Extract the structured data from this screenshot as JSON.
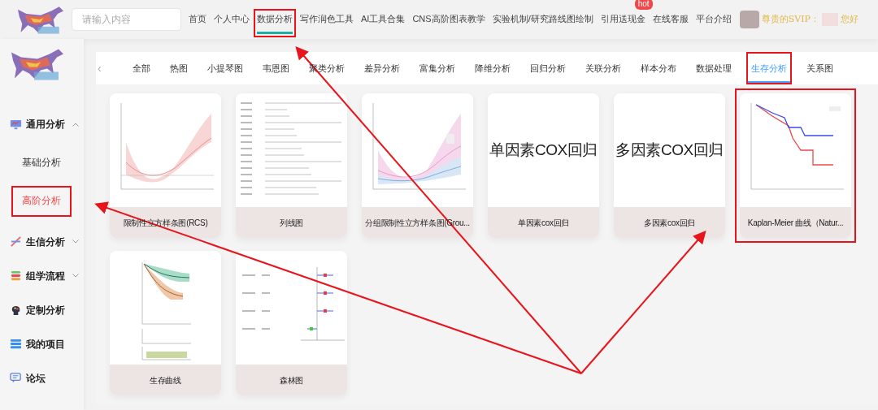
{
  "header": {
    "search": {
      "placeholder": "请输入内容"
    },
    "nav": [
      {
        "label": "首页",
        "selected": false,
        "highlighted": false
      },
      {
        "label": "个人中心",
        "selected": false,
        "highlighted": false
      },
      {
        "label": "数据分析",
        "selected": true,
        "highlighted": true
      },
      {
        "label": "写作润色工具",
        "selected": false,
        "highlighted": false
      },
      {
        "label": "AI工具合集",
        "selected": false,
        "highlighted": false
      },
      {
        "label": "CNS高阶图表教学",
        "selected": false,
        "highlighted": false
      },
      {
        "label": "实验机制/研究路线图绘制",
        "selected": false,
        "highlighted": false
      },
      {
        "label": "引用送现金",
        "selected": false,
        "highlighted": false,
        "badge": "hot"
      },
      {
        "label": "在线客服",
        "selected": false,
        "highlighted": false
      },
      {
        "label": "平台介绍",
        "selected": false,
        "highlighted": false
      }
    ],
    "greeting": {
      "prefix": "尊贵的SVIP：",
      "suffix": "您好"
    }
  },
  "sidebar": {
    "items": [
      {
        "label": "通用分析",
        "kind": "group",
        "expanded": true,
        "children": [
          {
            "label": "基础分析",
            "selected": false,
            "highlighted": false
          },
          {
            "label": "高阶分析",
            "selected": true,
            "highlighted": true
          }
        ]
      },
      {
        "label": "生信分析",
        "kind": "group",
        "expanded": false
      },
      {
        "label": "组学流程",
        "kind": "group",
        "expanded": false
      },
      {
        "label": "定制分析",
        "kind": "item"
      },
      {
        "label": "我的项目",
        "kind": "item"
      },
      {
        "label": "论坛",
        "kind": "item"
      }
    ]
  },
  "tabs": {
    "back": "‹",
    "items": [
      {
        "label": "全部",
        "selected": false,
        "highlighted": false
      },
      {
        "label": "热图",
        "selected": false,
        "highlighted": false
      },
      {
        "label": "小提琴图",
        "selected": false,
        "highlighted": false
      },
      {
        "label": "韦恩图",
        "selected": false,
        "highlighted": false
      },
      {
        "label": "聚类分析",
        "selected": false,
        "highlighted": false
      },
      {
        "label": "差异分析",
        "selected": false,
        "highlighted": false
      },
      {
        "label": "富集分析",
        "selected": false,
        "highlighted": false
      },
      {
        "label": "降维分析",
        "selected": false,
        "highlighted": false
      },
      {
        "label": "回归分析",
        "selected": false,
        "highlighted": false
      },
      {
        "label": "关联分析",
        "selected": false,
        "highlighted": false
      },
      {
        "label": "样本分布",
        "selected": false,
        "highlighted": false
      },
      {
        "label": "数据处理",
        "selected": false,
        "highlighted": false
      },
      {
        "label": "生存分析",
        "selected": true,
        "highlighted": true
      },
      {
        "label": "关系图",
        "selected": false,
        "highlighted": false
      }
    ]
  },
  "cards": [
    {
      "title": "限制性立方样条图(RCS)",
      "kind": "rcs",
      "highlighted": false
    },
    {
      "title": "列线图",
      "kind": "nomogram",
      "highlighted": false
    },
    {
      "title": "分组限制性立方样条图(Grou...",
      "kind": "grouped-rcs",
      "highlighted": false
    },
    {
      "title": "单因素cox回归",
      "kind": "text",
      "thumbnail_text": "单因素COX回归",
      "highlighted": false
    },
    {
      "title": "多因素cox回归",
      "kind": "text",
      "thumbnail_text": "多因素COX回归",
      "highlighted": false
    },
    {
      "title": "Kaplan-Meier 曲线（Natur...",
      "kind": "km",
      "highlighted": true
    },
    {
      "title": "生存曲线",
      "kind": "survival",
      "highlighted": false
    },
    {
      "title": "森林图",
      "kind": "forest",
      "highlighted": false
    }
  ]
}
